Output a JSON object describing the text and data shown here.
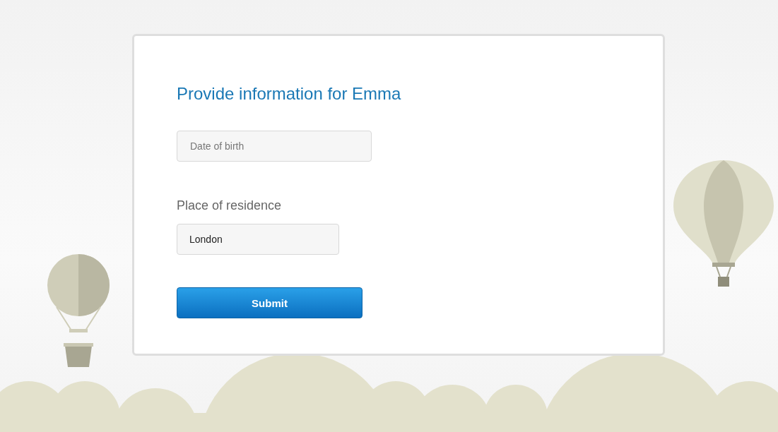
{
  "form": {
    "title": "Provide information for Emma",
    "fields": [
      {
        "placeholder": "Date of birth"
      },
      {
        "label": "Place of residence",
        "value": "London"
      }
    ],
    "submit": "Submit"
  }
}
